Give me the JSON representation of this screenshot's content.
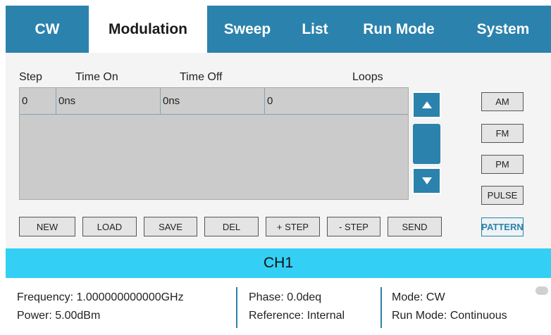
{
  "tabs": [
    {
      "label": "CW",
      "active": false
    },
    {
      "label": "Modulation",
      "active": true
    },
    {
      "label": "Sweep",
      "active": false
    },
    {
      "label": "List",
      "active": false
    },
    {
      "label": "Run Mode",
      "active": false
    },
    {
      "label": "System",
      "active": false
    }
  ],
  "table": {
    "headers": [
      "Step",
      "Time On",
      "Time Off",
      "Loops"
    ],
    "rows": [
      [
        "0",
        "0ns",
        "0ns",
        "0"
      ]
    ]
  },
  "actions": [
    "NEW",
    "LOAD",
    "SAVE",
    "DEL",
    "+ STEP",
    "- STEP",
    "SEND"
  ],
  "modulation_types": [
    "AM",
    "FM",
    "PM",
    "PULSE",
    "PATTERN"
  ],
  "selected_modulation": "PATTERN",
  "channel": "CH1",
  "status": {
    "frequency": "Frequency: 1.000000000000GHz",
    "power": "Power: 5.00dBm",
    "phase": "Phase: 0.0deq",
    "reference": "Reference: Internal",
    "mode": "Mode: CW",
    "run_mode": "Run Mode: Continuous"
  },
  "colors": {
    "accent": "#2b82ad",
    "channel_bar": "#33cff4",
    "grid": "#cbcbcb"
  },
  "icons": {
    "scroll_up": "triangle-up-icon",
    "scroll_down": "triangle-down-icon",
    "indicator": "status-dot-icon"
  }
}
